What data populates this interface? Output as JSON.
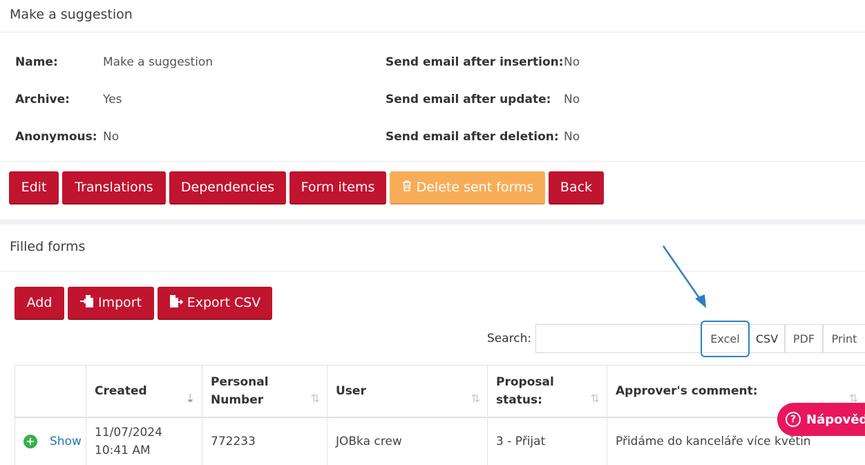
{
  "form_panel": {
    "title": "Make a suggestion",
    "details": {
      "name_label": "Name:",
      "name_value": "Make a suggestion",
      "archive_label": "Archive:",
      "archive_value": "Yes",
      "anonymous_label": "Anonymous:",
      "anonymous_value": "No",
      "email_insert_label": "Send email after insertion:",
      "email_insert_value": "No",
      "email_update_label": "Send email after update:",
      "email_update_value": "No",
      "email_delete_label": "Send email after deletion:",
      "email_delete_value": "No"
    },
    "actions": {
      "edit": "Edit",
      "translations": "Translations",
      "dependencies": "Dependencies",
      "form_items": "Form items",
      "delete_sent": "Delete sent forms",
      "back": "Back"
    }
  },
  "filled_forms": {
    "title": "Filled forms",
    "toolbar": {
      "add": "Add",
      "import": "Import",
      "export_csv": "Export CSV"
    },
    "search": {
      "label": "Search:",
      "placeholder": ""
    },
    "export_buttons": {
      "excel": "Excel",
      "csv": "CSV",
      "pdf": "PDF",
      "print": "Print"
    },
    "columns": [
      "",
      "Created",
      "Personal Number",
      "User",
      "Proposal status:",
      "Approver's comment:"
    ],
    "rows": [
      {
        "show": "Show",
        "created": "11/07/2024 10:41 AM",
        "personal_number": "772233",
        "user": "JOBka crew",
        "status": "3 - Přijat",
        "comment": "Přidáme do kanceláře více květin"
      }
    ]
  },
  "help": {
    "label": "Nápověda"
  },
  "colors": {
    "primary": "#c0142f",
    "warning": "#f7ad58",
    "help": "#e8175d",
    "highlight": "#2e7fc1",
    "success": "#36b24a"
  }
}
